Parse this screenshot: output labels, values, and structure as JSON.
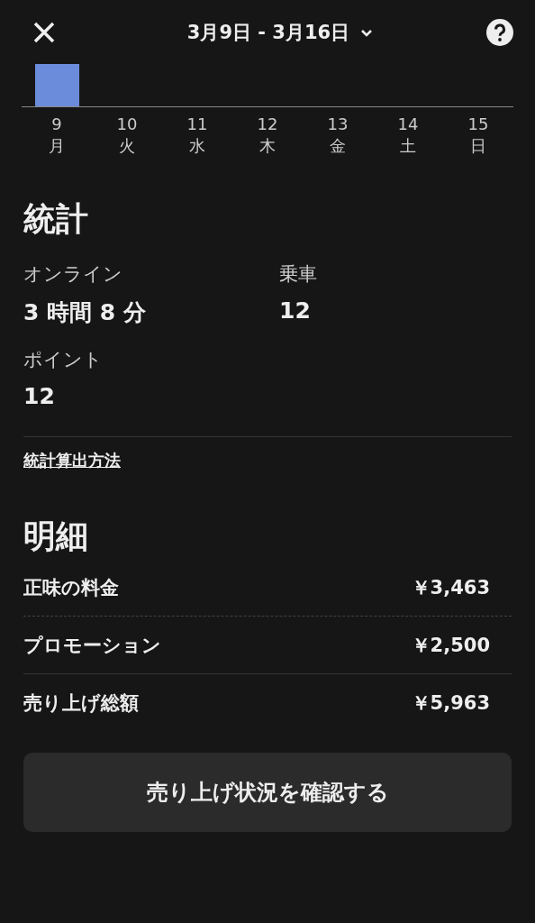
{
  "header": {
    "date_range": "3月9日 - 3月16日"
  },
  "chart": {
    "days": [
      {
        "date": "9",
        "weekday": "月",
        "has_earnings": true
      },
      {
        "date": "10",
        "weekday": "火",
        "has_earnings": false
      },
      {
        "date": "11",
        "weekday": "水",
        "has_earnings": false
      },
      {
        "date": "12",
        "weekday": "木",
        "has_earnings": false
      },
      {
        "date": "13",
        "weekday": "金",
        "has_earnings": false
      },
      {
        "date": "14",
        "weekday": "土",
        "has_earnings": false
      },
      {
        "date": "15",
        "weekday": "日",
        "has_earnings": false
      }
    ]
  },
  "stats": {
    "title": "統計",
    "items": [
      {
        "label": "オンライン",
        "value": "3 時間 8 分"
      },
      {
        "label": "乗車",
        "value": "12"
      },
      {
        "label": "ポイント",
        "value": "12"
      }
    ],
    "link": "統計算出方法"
  },
  "breakdown": {
    "title": "明細",
    "rows": [
      {
        "label": "正味の料金",
        "amount": "￥3,463",
        "dashed_divider": true
      },
      {
        "label": "プロモーション",
        "amount": "￥2,500",
        "dashed_divider": false
      },
      {
        "label": "売り上げ総額",
        "amount": "￥5,963"
      }
    ]
  },
  "button": "売り上げ状況を確認する"
}
